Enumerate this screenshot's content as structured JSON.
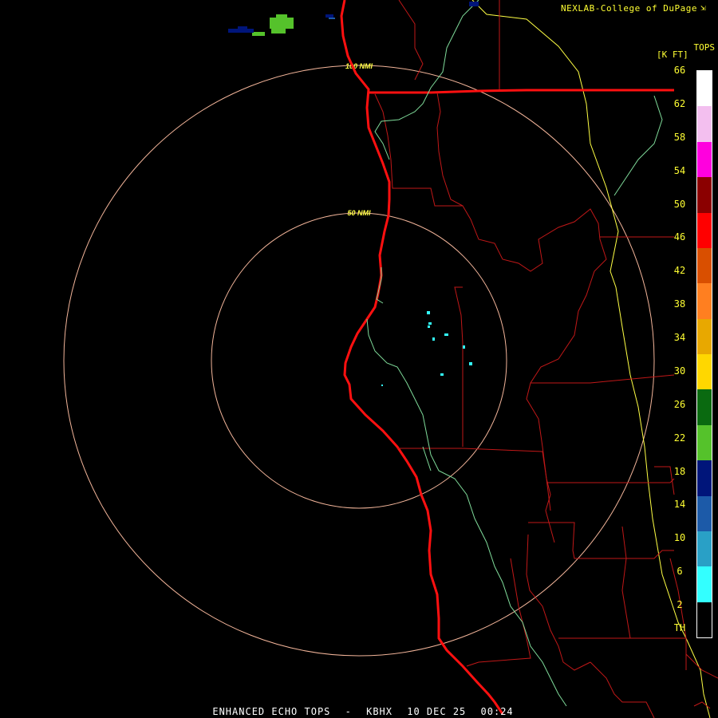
{
  "credit": "NEXLAB-College of DuPage",
  "credit_icon": "corner-arrow-icon",
  "legend": {
    "title": "TOPS",
    "units": "[K FT]",
    "labels": [
      "66",
      "62",
      "58",
      "54",
      "50",
      "46",
      "42",
      "38",
      "34",
      "30",
      "26",
      "22",
      "18",
      "14",
      "10",
      "6",
      "2",
      "TH"
    ],
    "colors": [
      "#ffffff",
      "#f3bfef",
      "#ff00de",
      "#8b0000",
      "#ff0000",
      "#d94f00",
      "#ff7f20",
      "#e8a800",
      "#ffd700",
      "#0a6a10",
      "#55c22b",
      "#00157a",
      "#1c5aa8",
      "#29a0c6",
      "#33ffff",
      "#000000"
    ]
  },
  "rings": {
    "inner_label": "50 NMI",
    "outer_label": "100 NMI",
    "color": "#f3b59a"
  },
  "map_colors": {
    "coastline": "#ff1010",
    "county": "#c01818",
    "state_line": "#ff1010",
    "river": "#7fdb9a",
    "yellow_line": "#ffff44",
    "echo_cyan": "#33ffff"
  },
  "footer": {
    "product": "ENHANCED ECHO TOPS",
    "station": "KBHX",
    "date": "10 DEC 25",
    "time": "00:24"
  }
}
